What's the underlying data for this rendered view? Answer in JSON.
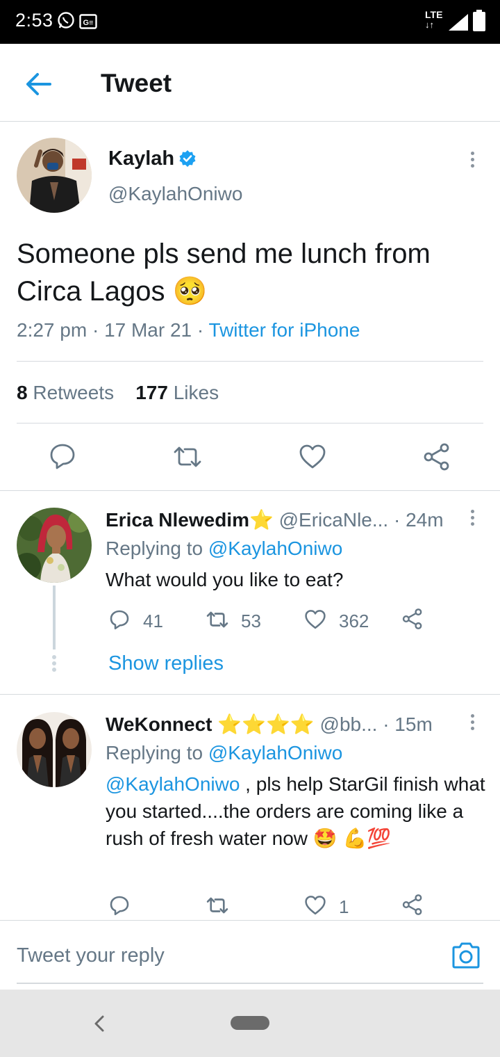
{
  "status_bar": {
    "time": "2:53",
    "network": "LTE"
  },
  "header": {
    "title": "Tweet"
  },
  "main_tweet": {
    "name": "Kaylah",
    "handle": "@KaylahOniwo",
    "text": "Someone pls send me lunch from Circa Lagos 🥺",
    "time": "2:27 pm",
    "date": "17 Mar 21",
    "source": "Twitter for iPhone",
    "retweets_count": "8",
    "retweets_label": "Retweets",
    "likes_count": "177",
    "likes_label": "Likes"
  },
  "replies": [
    {
      "name": "Erica Nlewedim⭐",
      "handle": "@EricaNle...",
      "time": "· 24m",
      "replying_prefix": "Replying to",
      "replying_to": "@KaylahOniwo",
      "text": "What would you like to eat?",
      "reply_count": "41",
      "retweet_count": "53",
      "like_count": "362",
      "show_replies": "Show replies"
    },
    {
      "name": "WeKonnect ⭐⭐⭐⭐",
      "handle": "@bb...",
      "time": "· 15m",
      "replying_prefix": "Replying to",
      "replying_to": "@KaylahOniwo",
      "mention": "@KaylahOniwo",
      "text": " , pls help StarGil finish what you started....the orders are coming like a rush of fresh water now 🤩 💪💯",
      "like_count": "1"
    }
  ],
  "composer": {
    "placeholder": "Tweet your reply"
  },
  "colors": {
    "accent": "#1b95e0",
    "text": "#14171a",
    "secondary": "#657786",
    "divider": "#d6dade",
    "verified": "#1da1f2"
  },
  "icons": [
    "back-arrow-icon",
    "verified-badge-icon",
    "more-options-icon",
    "reply-icon",
    "retweet-icon",
    "like-icon",
    "share-icon",
    "camera-icon",
    "whatsapp-icon",
    "gallery-icon",
    "signal-icon",
    "battery-icon"
  ]
}
